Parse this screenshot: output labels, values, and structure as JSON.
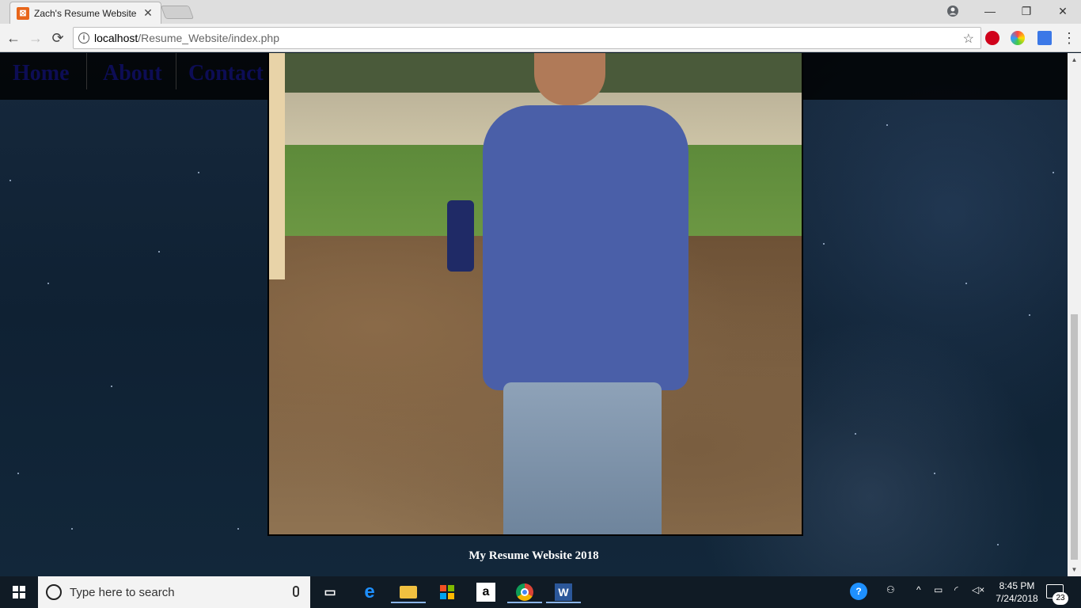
{
  "browser": {
    "tab": {
      "title": "Zach's Resume Website",
      "favicon_letter": "⊠"
    },
    "url": {
      "host": "localhost",
      "path": "/Resume_Website/index.php"
    }
  },
  "page": {
    "nav": [
      {
        "label": "Home"
      },
      {
        "label": "About"
      },
      {
        "label": "Contact"
      }
    ],
    "photo_alt": "Photo of Zach",
    "footer": "My Resume Website 2018"
  },
  "taskbar": {
    "search_placeholder": "Type here to search",
    "apps": [
      "task-view",
      "edge",
      "file-explorer",
      "store",
      "amazon",
      "chrome",
      "word"
    ],
    "clock": {
      "time": "8:45 PM",
      "date": "7/24/2018"
    },
    "notifications": "23"
  },
  "colors": {
    "nav_text": "#0d0d55",
    "navbar_bg": "#000000",
    "taskbar_bg": "#101b25"
  }
}
